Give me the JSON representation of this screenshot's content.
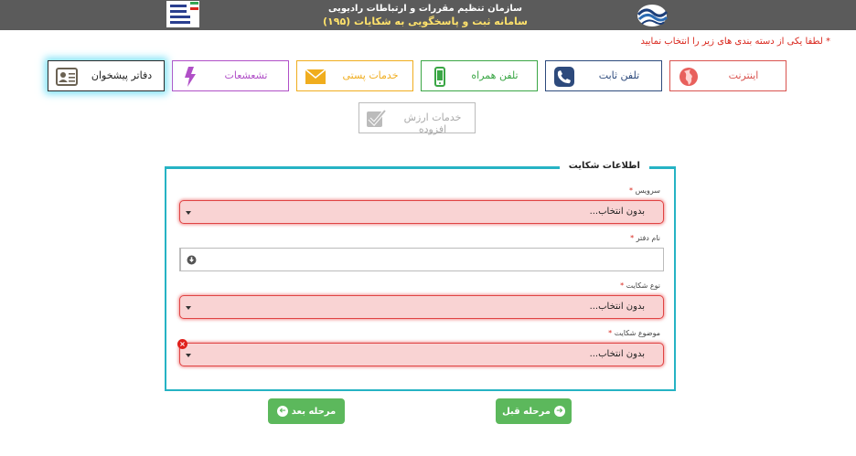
{
  "header": {
    "title_line1": "سازمان تنظیم مقررات و ارتباطات رادیویی",
    "title_line2": "سامانه ثبت و پاسخگویی به شکایات (۱۹۵)"
  },
  "instruction": "* لطفا یکی از دسته بندی های زیر را انتخاب نمایید",
  "categories": {
    "internet": "اینترنت",
    "landline": "تلفن ثابت",
    "mobile": "تلفن همراه",
    "postal": "خدمات پستی",
    "radiation": "تشعشعات",
    "offices": "دفاتر پیشخوان",
    "vas": "خدمات ارزش افزوده"
  },
  "form": {
    "legend": "اطلاعات شکایت",
    "required_mark": "*",
    "service": {
      "label": "سرویس",
      "value": "بدون انتخاب..."
    },
    "office_name": {
      "label": "نام دفتر",
      "value": ""
    },
    "complaint_type": {
      "label": "نوع شکایت",
      "value": "بدون انتخاب..."
    },
    "complaint_subject": {
      "label": "موضوع شکایت",
      "value": "بدون انتخاب..."
    }
  },
  "buttons": {
    "prev": "مرحله قبل",
    "next": "مرحله بعد"
  },
  "colors": {
    "header_bg": "#5b5b5b",
    "panel_border": "#26b3c4",
    "error_red": "#e04444",
    "button_green": "#5cb85c"
  }
}
